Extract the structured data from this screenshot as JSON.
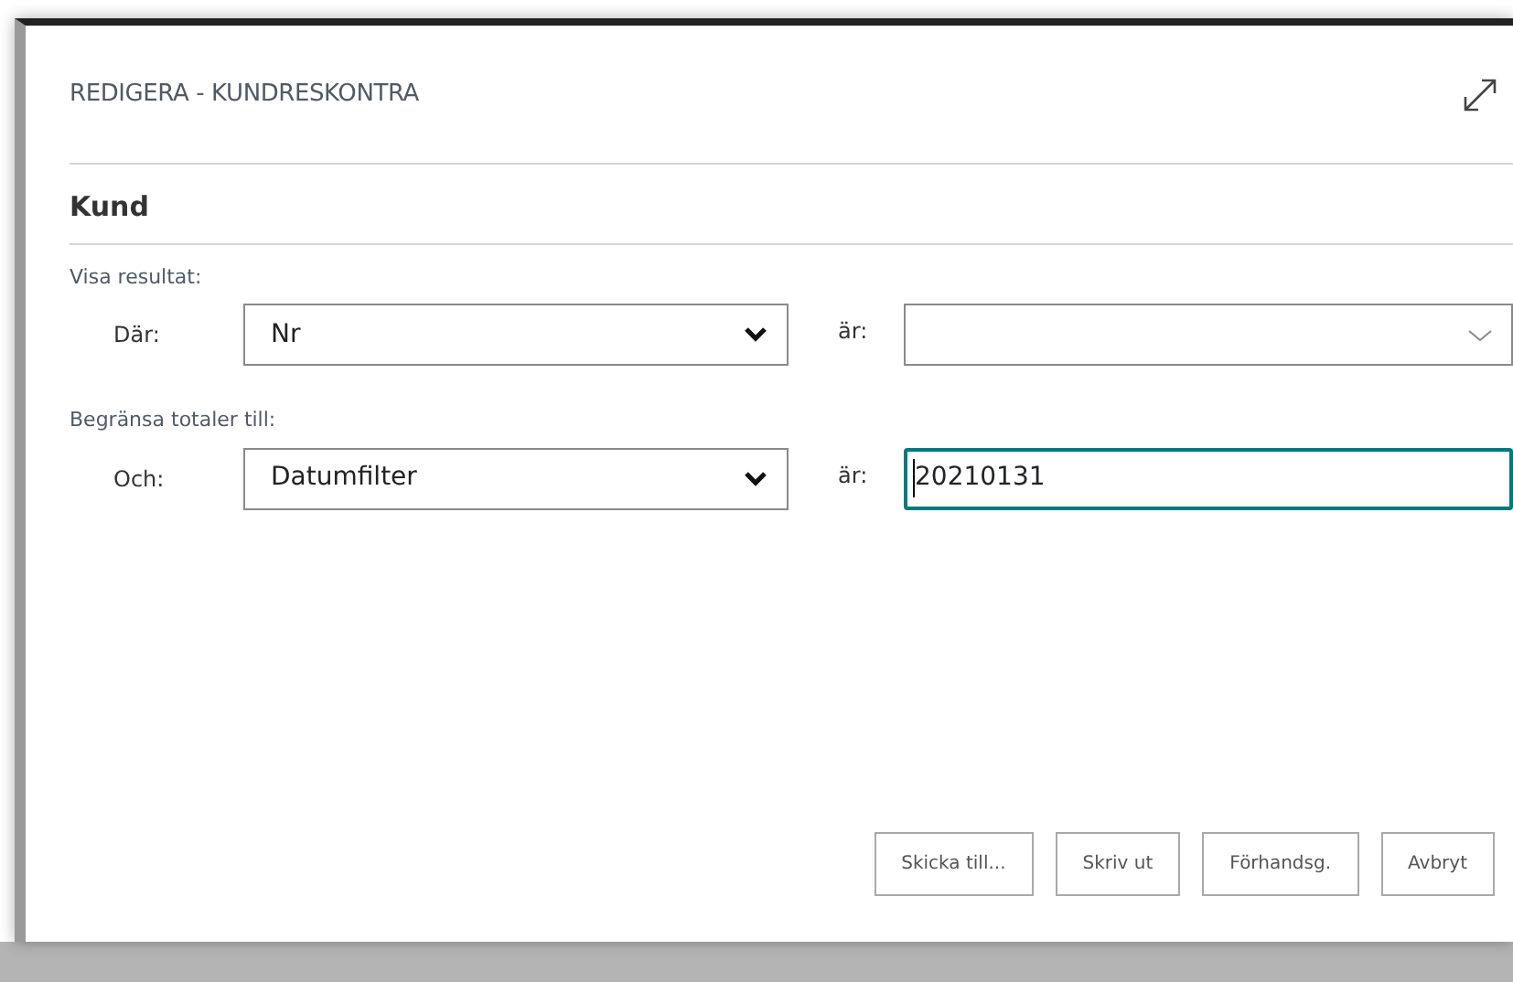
{
  "dialog": {
    "title": "REDIGERA - KUNDRESKONTRA"
  },
  "section": {
    "title": "Kund"
  },
  "groups": [
    {
      "caption": "Visa resultat:",
      "label": "Där:",
      "field": "Nr",
      "operator": "är:",
      "value": {
        "kind": "combo",
        "focused": false
      }
    },
    {
      "caption": "Begränsa totaler till:",
      "label": "Och:",
      "field": "Datumfilter",
      "operator": "är:",
      "value": {
        "kind": "text",
        "text": "20210131",
        "focused": true
      }
    }
  ],
  "buttons": [
    "Skicka till...",
    "Skriv ut",
    "Förhandsg.",
    "Avbryt"
  ]
}
